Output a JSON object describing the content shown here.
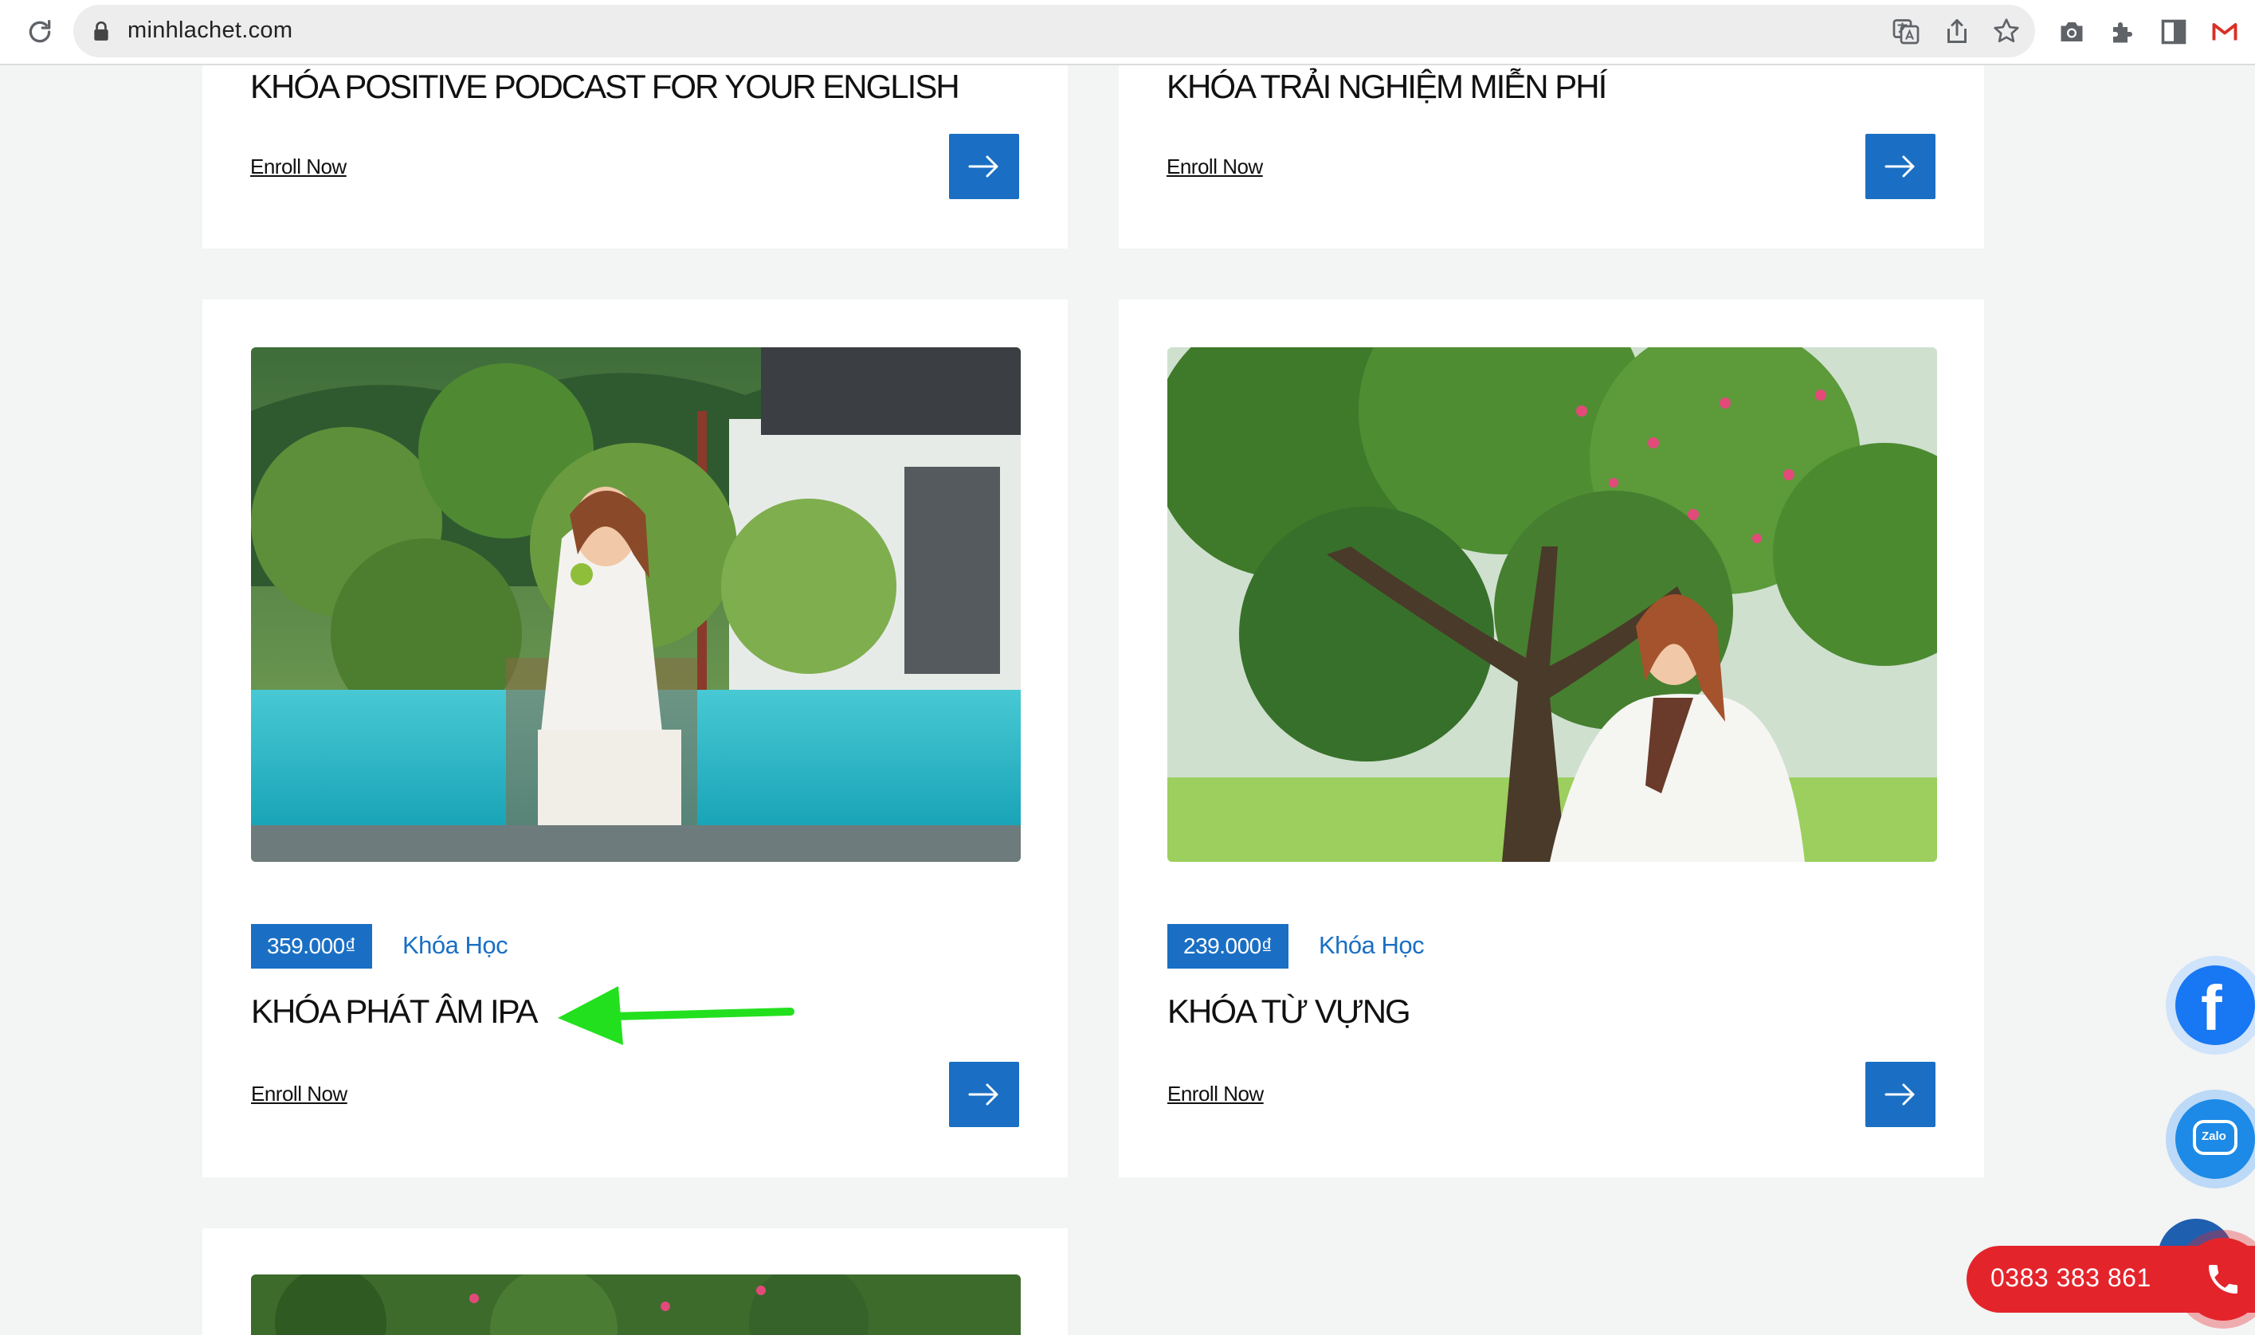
{
  "browser": {
    "url": "minhlachet.com"
  },
  "cards": [
    {
      "title": "KHÓA POSITIVE PODCAST FOR YOUR ENGLISH",
      "enroll_label": "Enroll Now"
    },
    {
      "title": "KHÓA TRẢI NGHIỆM MIỄN PHÍ",
      "enroll_label": "Enroll Now"
    },
    {
      "title": "KHÓA PHÁT ÂM IPA",
      "price": "359.000₫",
      "category": "Khóa Học",
      "enroll_label": "Enroll Now"
    },
    {
      "title": "KHÓA TỪ VỰNG",
      "price": "239.000₫",
      "category": "Khóa Học",
      "enroll_label": "Enroll Now"
    }
  ],
  "widgets": {
    "facebook_letter": "f",
    "zalo_label": "Zalo",
    "phone_number": "0383 383 861"
  },
  "colors": {
    "accent_blue": "#1a6fc4",
    "phone_red": "#e4242b",
    "annotation_green": "#22e01e",
    "page_bg": "#f3f4f4"
  }
}
